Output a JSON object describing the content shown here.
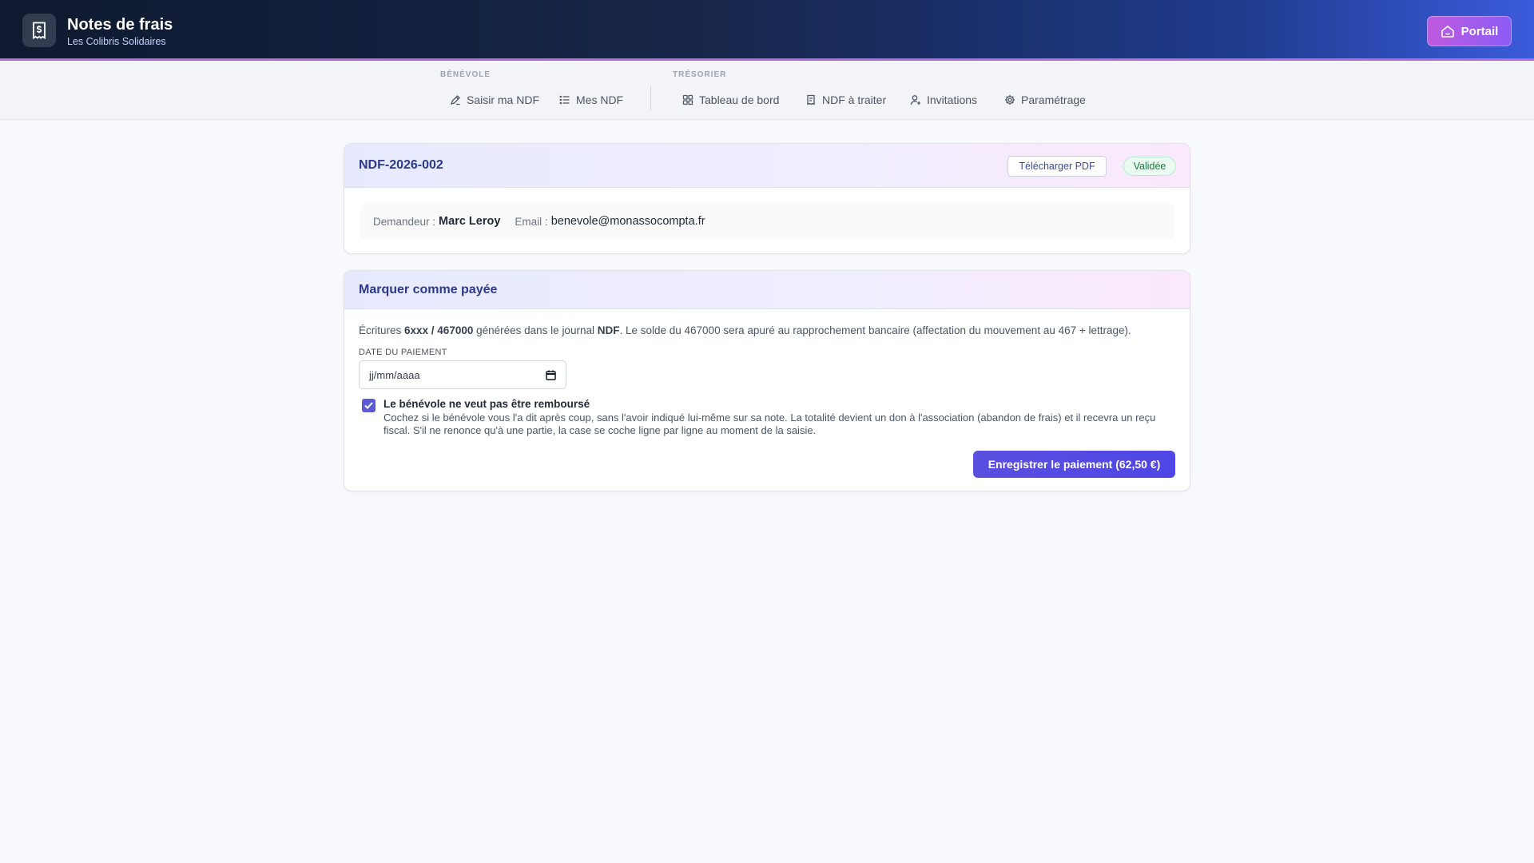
{
  "header": {
    "title": "Notes de frais",
    "subtitle": "Les Colibris Solidaires",
    "portal_label": "Portail"
  },
  "nav": {
    "groups": [
      {
        "label": "BÉNÉVOLE"
      },
      {
        "label": "TRÉSORIER"
      }
    ],
    "items": [
      {
        "label": "Saisir ma NDF",
        "icon": "pen-icon"
      },
      {
        "label": "Mes NDF",
        "icon": "list-icon"
      },
      {
        "label": "Tableau de bord",
        "icon": "grid-icon"
      },
      {
        "label": "NDF à traiter",
        "icon": "receipt-icon"
      },
      {
        "label": "Invitations",
        "icon": "user-plus-icon"
      },
      {
        "label": "Paramétrage",
        "icon": "gear-icon"
      }
    ]
  },
  "ndf_card": {
    "reference": "NDF-2026-002",
    "pdf_label": "Télécharger PDF",
    "status": "Validée",
    "requester_label": "Demandeur :",
    "requester_name": "Marc Leroy",
    "email_label": "Email :",
    "email": "benevole@monassocompta.fr"
  },
  "payment_card": {
    "title": "Marquer comme payée",
    "desc_prefix": "Écritures ",
    "desc_accounts": "6xxx / 467000",
    "desc_mid": " générées dans le journal ",
    "desc_journal": "NDF",
    "desc_suffix": ". Le solde du 467000 sera apuré au rapprochement bancaire (affectation du mouvement au 467 + lettrage).",
    "date_label": "DATE DU PAIEMENT",
    "date_placeholder": "jj/mm/aaaa",
    "checkbox_checked": true,
    "checkbox_title": "Le bénévole ne veut pas être remboursé",
    "checkbox_desc": "Cochez si le bénévole vous l'a dit après coup, sans l'avoir indiqué lui-même sur sa note. La totalité devient un don à l'association (abandon de frais) et il recevra un reçu fiscal. S'il ne renonce qu'à une partie, la case se coche ligne par ligne au moment de la saisie.",
    "save_label": "Enregistrer le paiement (62,50 €)"
  },
  "colors": {
    "accent": "#4f46e5",
    "status_green": "#15803d",
    "header_dark": "#0f1a30"
  }
}
